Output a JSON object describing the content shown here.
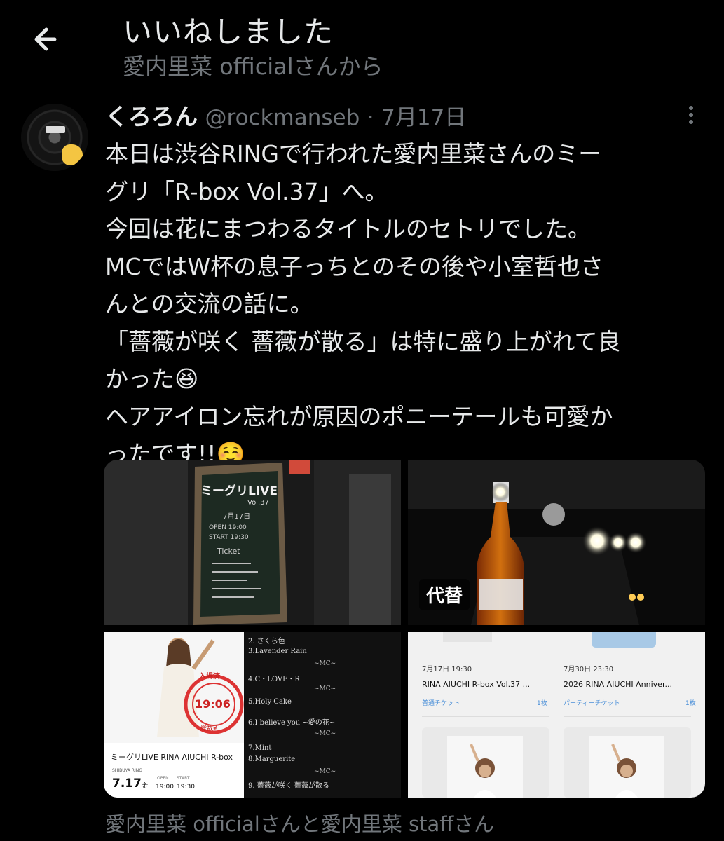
{
  "header": {
    "title": "いいねしました",
    "subtitle": "愛内里菜 officialさんから"
  },
  "tweet": {
    "name": "くろろん",
    "handle": "@rockmanseb",
    "separator": "·",
    "date": "7月17日",
    "lines": [
      "本日は渋谷RINGで行われた愛内里菜さんのミー",
      "グリ「R-box Vol.37」へ。",
      "今回は花にまつわるタイトルのセトリでした。",
      "MCではW杯の息子っちとのその後や小室哲也さ",
      "んとの交流の話に。",
      "「薔薇が咲く 薔薇が散る」は特に盛り上がれて良",
      "かった😆",
      "ヘアアイロン忘れが原因のポニーテールも可愛か",
      "ったです!!☺️"
    ]
  },
  "media": {
    "alt_badge": "代替",
    "board": {
      "title": "ミーグリLIVE",
      "vol": "Vol.37",
      "lines": [
        "7月17日",
        "OPEN 19:00",
        "START 19:30",
        "Ticket"
      ]
    },
    "ticket": {
      "stamp_top": "入場済",
      "stamp_time": "19:06",
      "stamp_bottom": "総数¥",
      "event": "ミーグリLIVE  RINA AIUCHI R-box",
      "venue": "SHIBUYA RING",
      "date": "7.17",
      "weekday": "金",
      "open_label": "OPEN",
      "open_time": "19:00",
      "start_label": "START",
      "start_time": "19:30"
    },
    "setlist": [
      "2. さくら色",
      "3.Lavender Rain",
      "~MC~",
      "4.C・LOVE・R",
      "~MC~",
      "5.Holy Cake",
      "6.I believe you ~愛の花~",
      "~MC~",
      "7.Mint",
      "8.Marguerite",
      "~MC~",
      "9. 薔薇が咲く 薔薇が散る"
    ],
    "app": {
      "card1": {
        "datetime": "7月17日 19:30",
        "title": "RINA AIUCHI R-box Vol.37 ...",
        "type": "普通チケット",
        "count": "1枚"
      },
      "card2": {
        "datetime": "7月30日 23:30",
        "title": "2026 RINA AIUCHI Anniver...",
        "type": "パーティーチケット",
        "count": "1枚"
      }
    }
  },
  "footer": {
    "liked_by": "愛内里菜 officialさんと愛内里菜 staffさん"
  },
  "colors": {
    "background": "#000000",
    "text": "#e7e9ea",
    "muted": "#71767b",
    "link_blue": "#4a8fd8"
  }
}
